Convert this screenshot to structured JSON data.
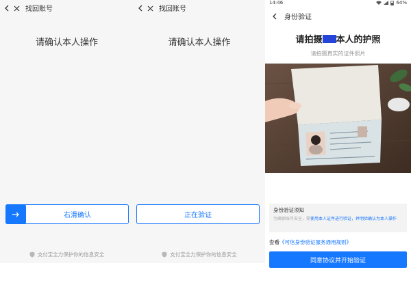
{
  "panel1": {
    "nav_title": "找回账号",
    "heading": "请确认本人操作",
    "slider_label": "右滑确认",
    "footer_text": "支付宝全力保护你的信息安全"
  },
  "panel2": {
    "nav_title": "找回账号",
    "heading": "请确认本人操作",
    "verify_label": "正在验证",
    "footer_text": "支付宝全力保护你的信息安全"
  },
  "panel3": {
    "status_time": "14:46",
    "status_battery": "64%",
    "nav_title": "身份验证",
    "title_before": "请拍摄",
    "title_after": "本人的护照",
    "subtitle": "请拍摄真实的证件照片",
    "notice_title": "身份验证须知",
    "notice_text_a": "为确保账号安全，需",
    "notice_text_hl": "使用本人证件进行验证，并明验确认为本人操作",
    "rules_prefix": "查看",
    "rules_link": "《可信身份验证服务通用规则》",
    "agree_button": "同意协议并开始验证"
  },
  "colors": {
    "accent": "#1677ff",
    "redaction": "#2446d8",
    "gray_bg": "#f6f6f7"
  },
  "icons": [
    "back-arrow-icon",
    "close-icon",
    "right-arrow-icon",
    "shield-icon",
    "wifi-icon",
    "signal-icon",
    "battery-icon"
  ]
}
